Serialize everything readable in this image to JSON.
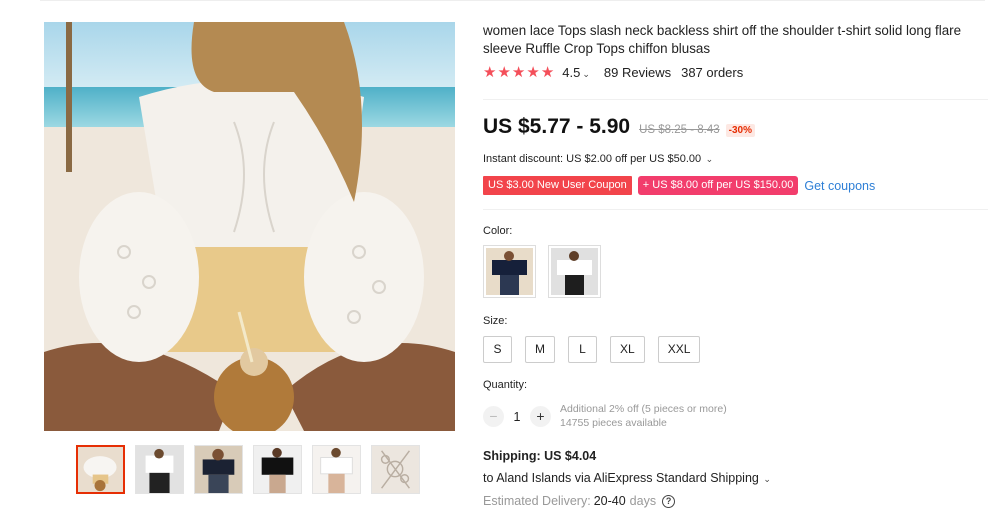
{
  "product": {
    "title": "women lace Tops slash neck backless shirt off the shoulder t-shirt solid long flare sleeve Ruffle Crop Tops chiffon blusas"
  },
  "rating": {
    "stars": 4.5,
    "value": "4.5",
    "reviews": "89 Reviews",
    "orders": "387 orders"
  },
  "price": {
    "current": "US $5.77 - 5.90",
    "original": "US $8.25 - 8.43",
    "discount": "-30%"
  },
  "discounts": {
    "instant": "Instant discount: US $2.00 off per US $50.00",
    "coupon_new_user": "US $3.00 New User Coupon",
    "coupon_store": "+ US $8.00 off per US $150.00",
    "get_coupons": "Get coupons"
  },
  "color": {
    "label": "Color:",
    "options": [
      "black",
      "white"
    ]
  },
  "size": {
    "label": "Size:",
    "options": [
      "S",
      "M",
      "L",
      "XL",
      "XXL"
    ]
  },
  "quantity": {
    "label": "Quantity:",
    "value": "1",
    "minus": "−",
    "plus": "+",
    "offer": "Additional 2% off (5 pieces or more)",
    "available": "14755 pieces available"
  },
  "shipping": {
    "title": "Shipping: US $4.04",
    "to": "to Aland Islands via AliExpress Standard Shipping",
    "delivery_label": "Estimated Delivery:",
    "delivery_value": "20-40",
    "delivery_unit": "days"
  },
  "colors": {
    "accent": "#e62e04",
    "star": "#f44f5a",
    "coupon": "#f2444b",
    "link": "#2e7fd6"
  }
}
